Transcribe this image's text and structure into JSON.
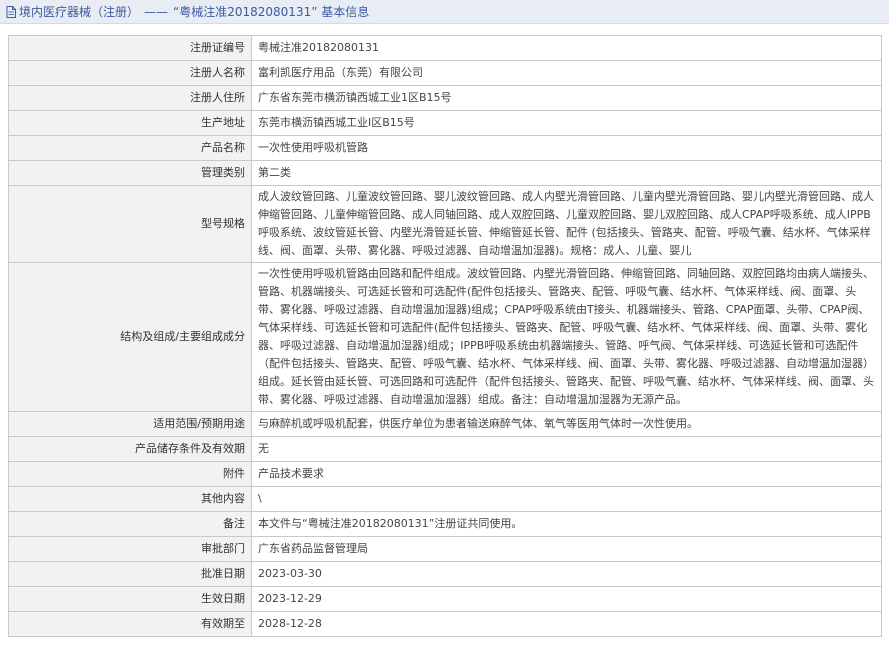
{
  "header": {
    "section": "境内医疗器械（注册）",
    "separator": "——",
    "record_title": "“粤械注准20182080131” 基本信息"
  },
  "rows": [
    {
      "label": "注册证编号",
      "value": "粤械注准20182080131"
    },
    {
      "label": "注册人名称",
      "value": "富利凯医疗用品（东莞）有限公司"
    },
    {
      "label": "注册人住所",
      "value": "广东省东莞市横沥镇西城工业1区B15号"
    },
    {
      "label": "生产地址",
      "value": "东莞市横沥镇西城工业I区B15号"
    },
    {
      "label": "产品名称",
      "value": "一次性使用呼吸机管路"
    },
    {
      "label": "管理类别",
      "value": "第二类"
    },
    {
      "label": "型号规格",
      "value": "成人波纹管回路、儿童波纹管回路、婴儿波纹管回路、成人内壁光滑管回路、儿童内壁光滑管回路、婴儿内壁光滑管回路、成人伸缩管回路、儿童伸缩管回路、成人同轴回路、成人双腔回路、儿童双腔回路、婴儿双腔回路、成人CPAP呼吸系统、成人IPPB呼吸系统、波纹管延长管、内壁光滑管延长管、伸缩管延长管、配件 (包括接头、管路夹、配管、呼吸气囊、结水杯、气体采样线、阀、面罩、头带、雾化器、呼吸过滤器、自动增温加湿器)。规格：成人、儿童、婴儿"
    },
    {
      "label": "结构及组成/主要组成成分",
      "value": "一次性使用呼吸机管路由回路和配件组成。波纹管回路、内壁光滑管回路、伸缩管回路、同轴回路、双腔回路均由病人端接头、管路、机器端接头、可选延长管和可选配件(配件包括接头、管路夹、配管、呼吸气囊、结水杯、气体采样线、阀、面罩、头带、雾化器、呼吸过滤器、自动增温加湿器)组成；CPAP呼吸系统由T接头、机器端接头、管路、CPAP面罩、头带、CPAP阀、气体采样线、可选延长管和可选配件(配件包括接头、管路夹、配管、呼吸气囊、结水杯、气体采样线、阀、面罩、头带、雾化器、呼吸过滤器、自动增温加湿器)组成；IPPB呼吸系统由机器端接头、管路、呼气阀、气体采样线、可选延长管和可选配件（配件包括接头、管路夹、配管、呼吸气囊、结水杯、气体采样线、阀、面罩、头带、雾化器、呼吸过滤器、自动增温加湿器）组成。延长管由延长管、可选回路和可选配件（配件包括接头、管路夹、配管、呼吸气囊、结水杯、气体采样线、阀、面罩、头带、雾化器、呼吸过滤器、自动增温加湿器）组成。备注：自动增温加湿器为无源产品。"
    },
    {
      "label": "适用范围/预期用途",
      "value": "与麻醉机或呼吸机配套，供医疗单位为患者输送麻醉气体、氧气等医用气体时一次性使用。"
    },
    {
      "label": "产品储存条件及有效期",
      "value": "无"
    },
    {
      "label": "附件",
      "value": "产品技术要求"
    },
    {
      "label": "其他内容",
      "value": "\\"
    },
    {
      "label": "备注",
      "value": "本文件与“粤械注准20182080131”注册证共同使用。"
    },
    {
      "label": "审批部门",
      "value": "广东省药品监督管理局"
    },
    {
      "label": "批准日期",
      "value": "2023-03-30"
    },
    {
      "label": "生效日期",
      "value": "2023-12-29"
    },
    {
      "label": "有效期至",
      "value": "2028-12-28"
    }
  ]
}
